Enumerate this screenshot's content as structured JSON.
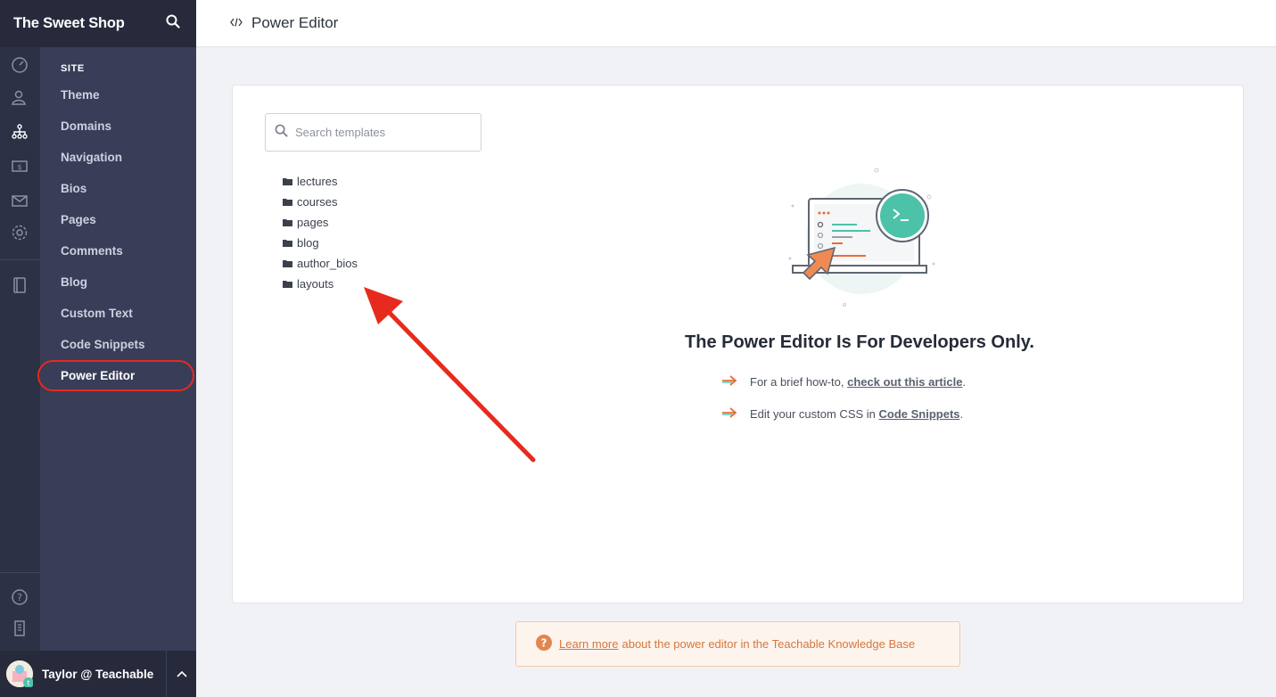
{
  "school_name": "The Sweet Shop",
  "header": {
    "title": "Power Editor"
  },
  "sidebar": {
    "section_heading": "SITE",
    "items": [
      {
        "label": "Theme"
      },
      {
        "label": "Domains"
      },
      {
        "label": "Navigation"
      },
      {
        "label": "Bios"
      },
      {
        "label": "Pages"
      },
      {
        "label": "Comments"
      },
      {
        "label": "Blog"
      },
      {
        "label": "Custom Text"
      },
      {
        "label": "Code Snippets"
      },
      {
        "label": "Power Editor"
      }
    ],
    "active_item": "Power Editor",
    "rail_icons": [
      "dashboard-icon",
      "users-icon",
      "site-icon",
      "sales-icon",
      "email-icon",
      "settings-icon",
      "courses-icon",
      "help-icon",
      "school-icon"
    ]
  },
  "user": {
    "name": "Taylor @ Teachable"
  },
  "search": {
    "placeholder": "Search templates",
    "value": ""
  },
  "folders": [
    "lectures",
    "courses",
    "pages",
    "blog",
    "author_bios",
    "layouts"
  ],
  "empty_state": {
    "title": "The Power Editor Is For Developers Only.",
    "tip1_prefix": "For a brief how-to, ",
    "tip1_link": "check out this article",
    "tip1_suffix": ".",
    "tip2_prefix": "Edit your custom CSS in ",
    "tip2_link": "Code Snippets",
    "tip2_suffix": "."
  },
  "callout": {
    "link": "Learn more",
    "text": "about the power editor in the Teachable Knowledge Base"
  },
  "colors": {
    "sidebar_dark": "#262a3b",
    "sidebar_rail": "#2d3146",
    "sidebar_subnav": "#393d58",
    "accent_orange": "#d6773b",
    "annotation_red": "#e62b1e",
    "teal": "#4cc2a9"
  }
}
